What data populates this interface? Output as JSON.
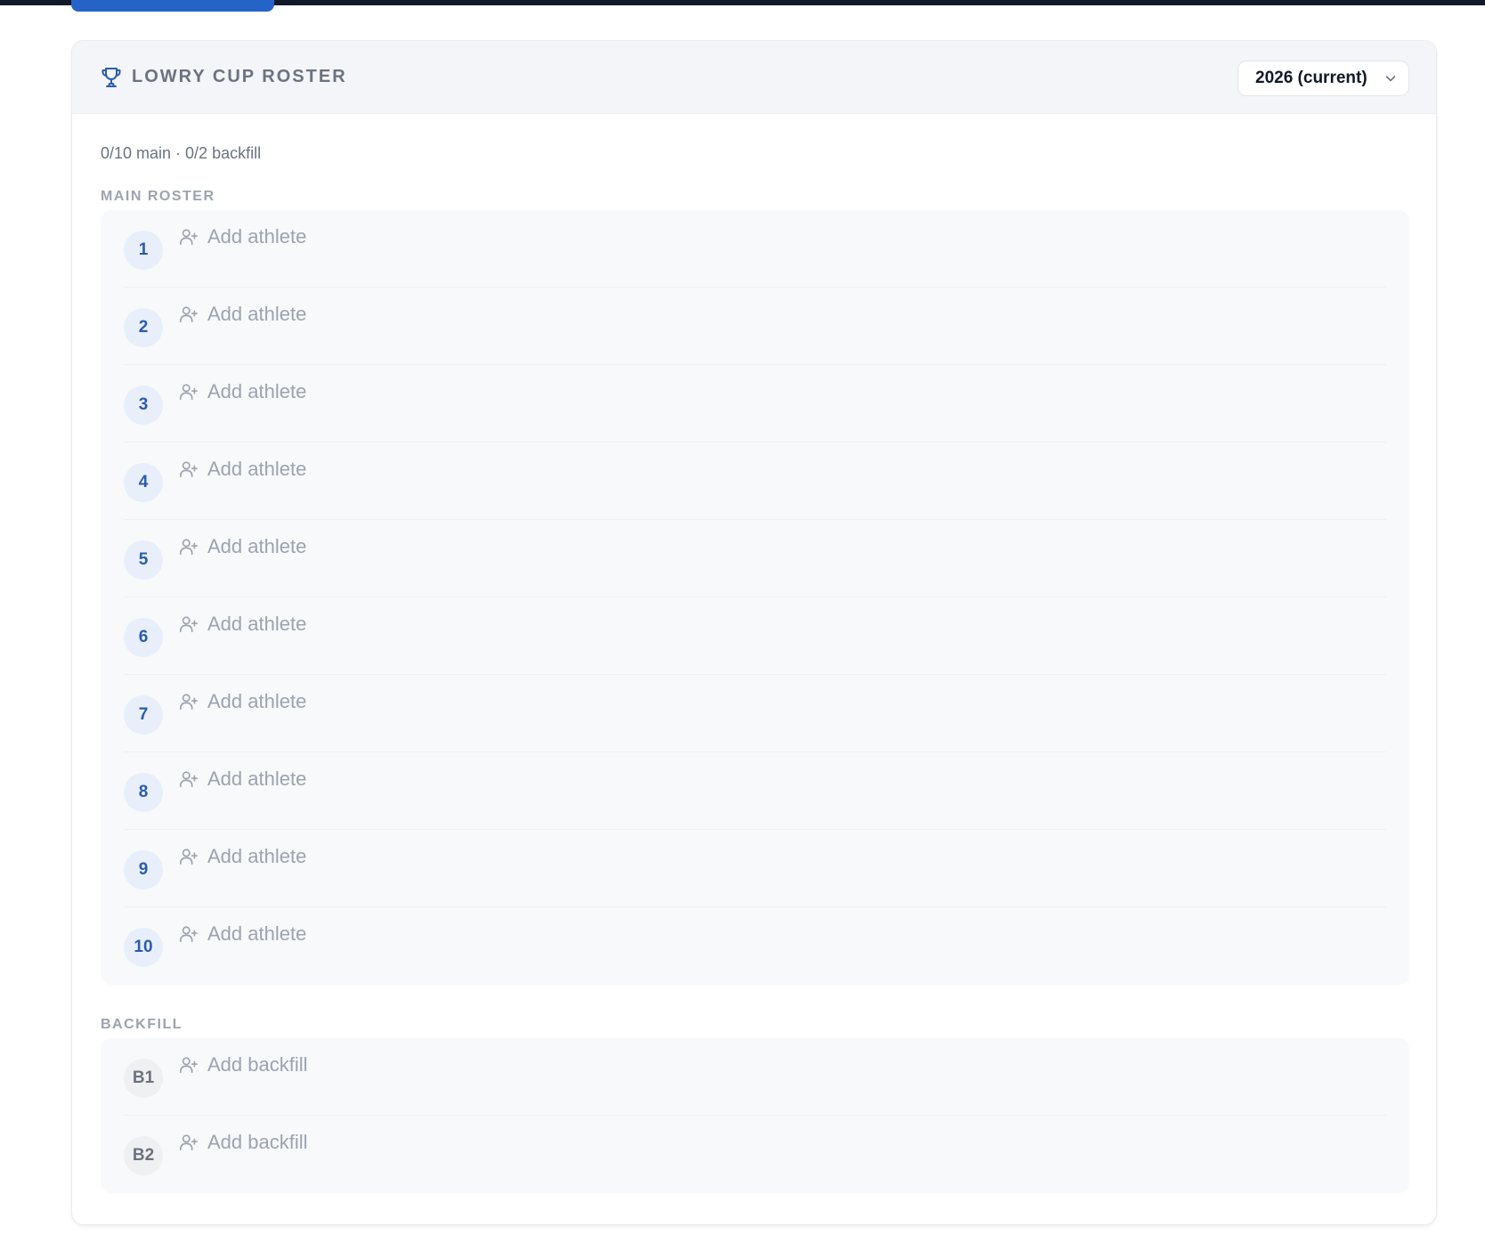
{
  "card": {
    "title": "LOWRY CUP ROSTER",
    "season_select": {
      "value": "2026 (current)"
    },
    "summary": "0/10 main · 0/2 backfill"
  },
  "main_roster": {
    "label": "MAIN ROSTER",
    "slots": [
      {
        "badge": "1",
        "action": "Add athlete"
      },
      {
        "badge": "2",
        "action": "Add athlete"
      },
      {
        "badge": "3",
        "action": "Add athlete"
      },
      {
        "badge": "4",
        "action": "Add athlete"
      },
      {
        "badge": "5",
        "action": "Add athlete"
      },
      {
        "badge": "6",
        "action": "Add athlete"
      },
      {
        "badge": "7",
        "action": "Add athlete"
      },
      {
        "badge": "8",
        "action": "Add athlete"
      },
      {
        "badge": "9",
        "action": "Add athlete"
      },
      {
        "badge": "10",
        "action": "Add athlete"
      }
    ]
  },
  "backfill": {
    "label": "BACKFILL",
    "slots": [
      {
        "badge": "B1",
        "action": "Add backfill"
      },
      {
        "badge": "B2",
        "action": "Add backfill"
      }
    ]
  },
  "icons": {
    "header": "trophy-icon",
    "select": "chevron-down-icon",
    "slot_action": "user-plus-icon"
  },
  "colors": {
    "accent": "#2563c9",
    "badge_main_text": "#2a5cad",
    "badge_main_bg": "#e8effa",
    "muted_text": "#9ca3af",
    "header_bg": "#f4f5f8",
    "top_bar": "#111827"
  }
}
